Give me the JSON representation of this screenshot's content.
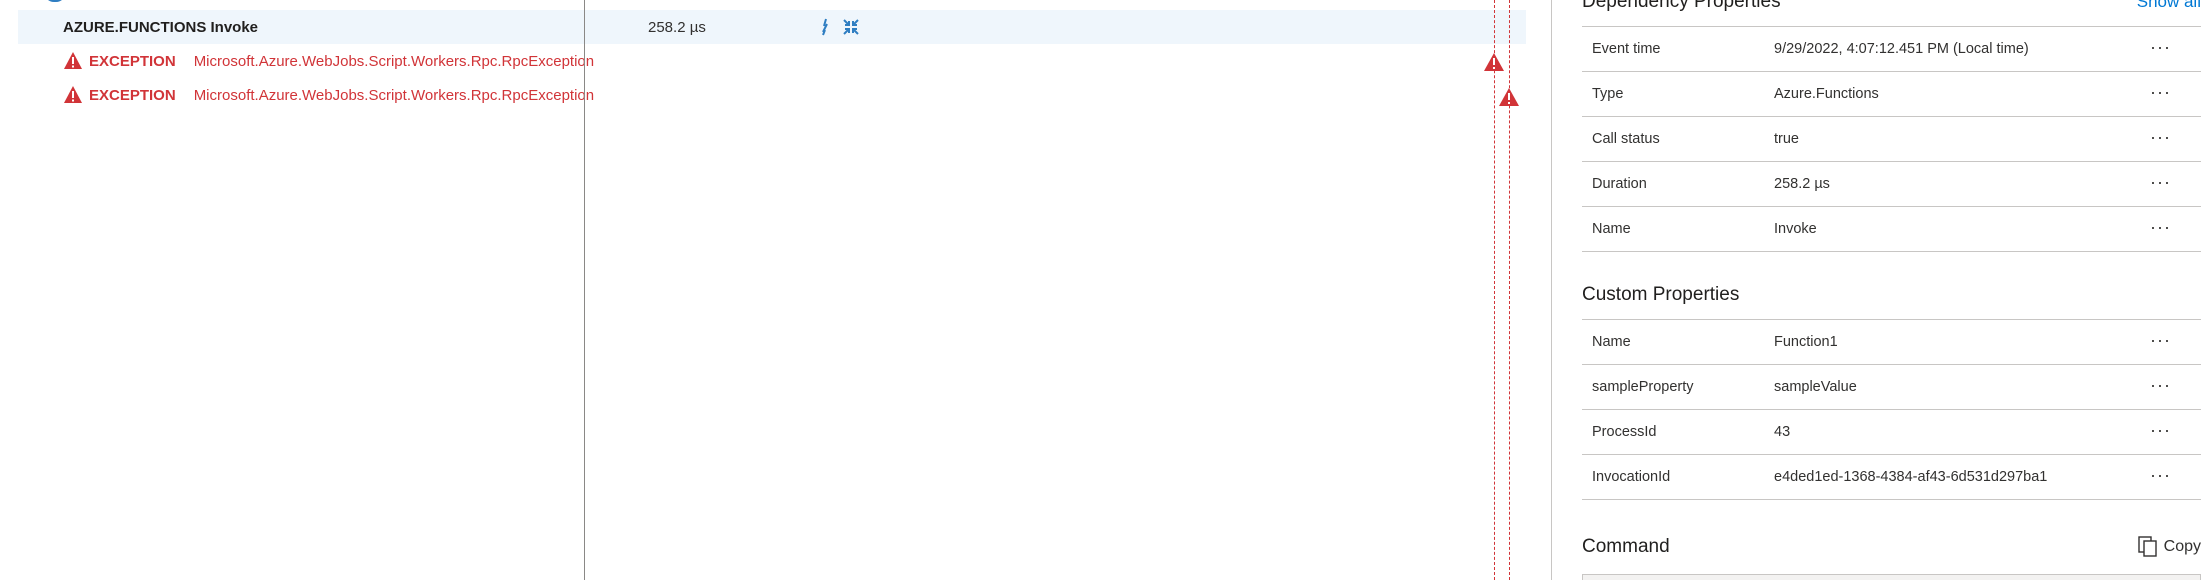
{
  "timeline": {
    "selected_row": {
      "name": "AZURE.FUNCTIONS Invoke",
      "duration": "258.2 µs"
    },
    "exceptions": [
      {
        "label": "EXCEPTION",
        "type": "Microsoft.Azure.WebJobs.Script.Workers.Rpc.RpcException"
      },
      {
        "label": "EXCEPTION",
        "type": "Microsoft.Azure.WebJobs.Script.Workers.Rpc.RpcException"
      }
    ]
  },
  "dependency": {
    "title": "Dependency Properties",
    "show_all": "Show all",
    "rows": [
      {
        "key": "Event time",
        "value": "9/29/2022, 4:07:12.451 PM (Local time)"
      },
      {
        "key": "Type",
        "value": "Azure.Functions"
      },
      {
        "key": "Call status",
        "value": "true"
      },
      {
        "key": "Duration",
        "value": "258.2 µs"
      },
      {
        "key": "Name",
        "value": "Invoke"
      }
    ]
  },
  "custom": {
    "title": "Custom Properties",
    "rows": [
      {
        "key": "Name",
        "value": "Function1"
      },
      {
        "key": "sampleProperty",
        "value": "sampleValue"
      },
      {
        "key": "ProcessId",
        "value": "43"
      },
      {
        "key": "InvocationId",
        "value": "e4ded1ed-1368-4384-af43-6d531d297ba1"
      }
    ]
  },
  "command": {
    "title": "Command",
    "copy_label": "Copy"
  },
  "more_glyph": "···",
  "colors": {
    "error": "#d13438",
    "link": "#0078d4",
    "selected_bg": "#eff6fc"
  },
  "icons": [
    "warning-icon",
    "fork-icon",
    "collapse-icon",
    "copy-icon",
    "more-icon"
  ]
}
